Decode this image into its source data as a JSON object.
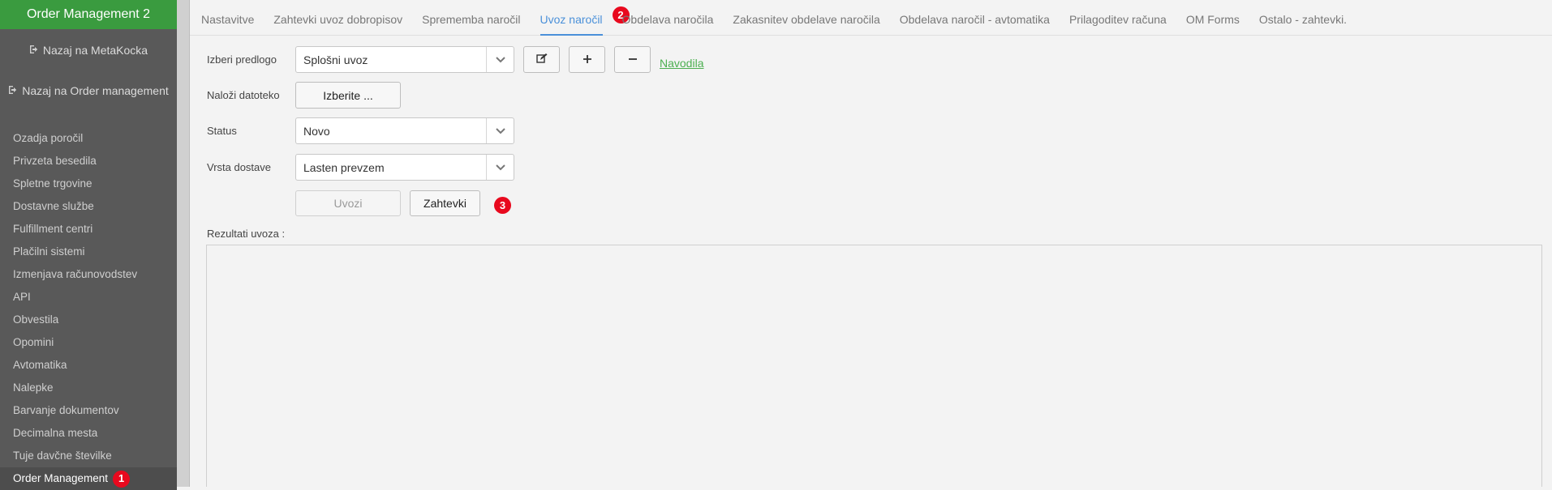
{
  "sidebar": {
    "title": "Order Management 2",
    "back_metakocka": "Nazaj na MetaKocka",
    "back_order_management": "Nazaj na Order management",
    "items": [
      {
        "label": "Ozadja poročil"
      },
      {
        "label": "Privzeta besedila"
      },
      {
        "label": "Spletne trgovine"
      },
      {
        "label": "Dostavne službe"
      },
      {
        "label": "Fulfillment centri"
      },
      {
        "label": "Plačilni sistemi"
      },
      {
        "label": "Izmenjava računovodstev"
      },
      {
        "label": "API"
      },
      {
        "label": "Obvestila"
      },
      {
        "label": "Opomini"
      },
      {
        "label": "Avtomatika"
      },
      {
        "label": "Nalepke"
      },
      {
        "label": "Barvanje dokumentov"
      },
      {
        "label": "Decimalna mesta"
      },
      {
        "label": "Tuje davčne številke"
      },
      {
        "label": "Order Management",
        "active": true,
        "badge": "1"
      }
    ]
  },
  "tabs": [
    {
      "label": "Nastavitve"
    },
    {
      "label": "Zahtevki uvoz dobropisov"
    },
    {
      "label": "Sprememba naročil"
    },
    {
      "label": "Uvoz naročil",
      "active": true,
      "badge": "2"
    },
    {
      "label": "Obdelava naročila"
    },
    {
      "label": "Zakasnitev obdelave naročila"
    },
    {
      "label": "Obdelava naročil - avtomatika"
    },
    {
      "label": "Prilagoditev računa"
    },
    {
      "label": "OM Forms"
    },
    {
      "label": "Ostalo - zahtevki."
    }
  ],
  "form": {
    "template_label": "Izberi predlogo",
    "template_value": "Splošni uvoz",
    "upload_label": "Naloži datoteko",
    "upload_button": "Izberite ...",
    "status_label": "Status",
    "status_value": "Novo",
    "delivery_label": "Vrsta dostave",
    "delivery_value": "Lasten prevzem",
    "import_button": "Uvozi",
    "requests_button": "Zahtevki",
    "requests_badge": "3",
    "help_link": "Navodila",
    "results_label": "Rezultati uvoza :"
  },
  "icons": {
    "edit": "edit-icon",
    "plus": "plus-icon",
    "minus": "minus-icon",
    "chevron": "chevron-down-icon",
    "signout": "sign-out-icon"
  },
  "colors": {
    "sidebar_bg": "#595959",
    "sidebar_title_bg": "#3a9b3f",
    "active_tab": "#4a90d9",
    "badge": "#e8091e",
    "link": "#4caf50"
  }
}
